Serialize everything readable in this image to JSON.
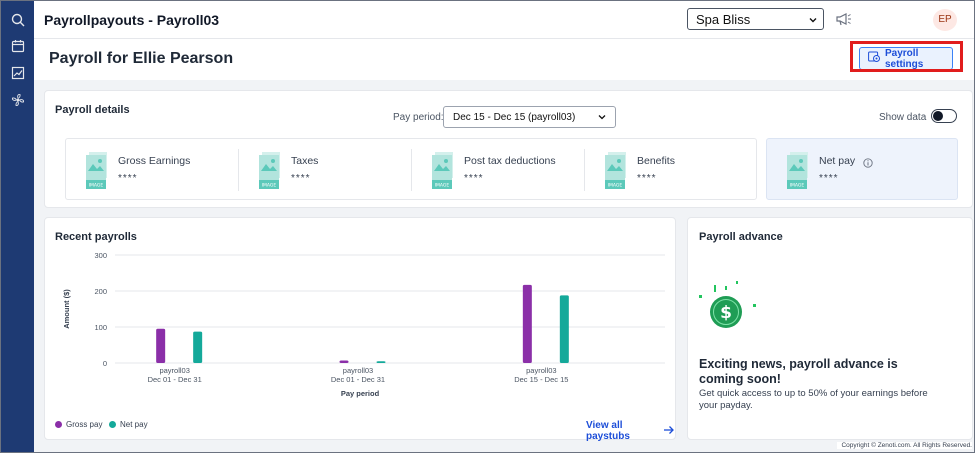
{
  "app": {
    "title": "Payrollpayouts - Payroll03"
  },
  "header": {
    "location_selected": "Spa Bliss",
    "avatar_initials": "EP",
    "icons": [
      "announcement-icon"
    ]
  },
  "sidebar": {
    "icons": [
      "search-icon",
      "calendar-icon",
      "reports-icon",
      "fan-icon"
    ]
  },
  "page": {
    "title_prefix": "Payroll for",
    "employee_name": "Ellie Pearson",
    "settings_button": "Payroll settings"
  },
  "payroll_details": {
    "title": "Payroll details",
    "pay_period_label": "Pay period:",
    "pay_period_value": "Dec 15 - Dec 15 (payroll03)",
    "show_data_label": "Show data",
    "show_data_enabled": false,
    "items": [
      {
        "label": "Gross Earnings",
        "value": "****"
      },
      {
        "label": "Taxes",
        "value": "****"
      },
      {
        "label": "Post tax deductions",
        "value": "****"
      },
      {
        "label": "Benefits",
        "value": "****"
      },
      {
        "label": "Net pay",
        "value": "****"
      }
    ],
    "placeholder_image_text": [
      "IMAGE",
      "IMAGE",
      "IMAGE",
      "IMAGE",
      "IMAGE"
    ]
  },
  "recent_payrolls": {
    "title": "Recent payrolls",
    "view_all_label": "View all paystubs"
  },
  "chart_data": {
    "type": "bar",
    "categories": [
      "payroll03\nDec 01 - Dec 31",
      "payroll03\nDec 01 - Dec 31",
      "payroll03\nDec 15 - Dec 15"
    ],
    "category_lines": [
      [
        "payroll03",
        "Dec 01 - Dec 31"
      ],
      [
        "payroll03",
        "Dec 01 - Dec 31"
      ],
      [
        "payroll03",
        "Dec 15 - Dec 15"
      ]
    ],
    "series": [
      {
        "name": "Gross pay",
        "color": "#8b2fa8",
        "values": [
          95,
          7,
          217
        ]
      },
      {
        "name": "Net pay",
        "color": "#14a99a",
        "values": [
          87,
          5,
          188
        ]
      }
    ],
    "xlabel": "Pay period",
    "ylabel": "Amount ($)",
    "ylim": [
      0,
      300
    ],
    "yticks": [
      0,
      100,
      200,
      300
    ],
    "grid": true,
    "legend": "bottom-left"
  },
  "payroll_advance": {
    "title": "Payroll advance",
    "headline": "Exciting news, payroll advance is coming soon!",
    "description": "Get quick access to up to 50% of your earnings before your payday.",
    "icon_symbol": "$"
  },
  "footer": {
    "copyright": "Copyright © Zenoti.com. All Rights Reserved."
  },
  "colors": {
    "sidebar": "#1e3a73",
    "accent": "#1d4ed8",
    "highlight": "#e11d1d"
  }
}
